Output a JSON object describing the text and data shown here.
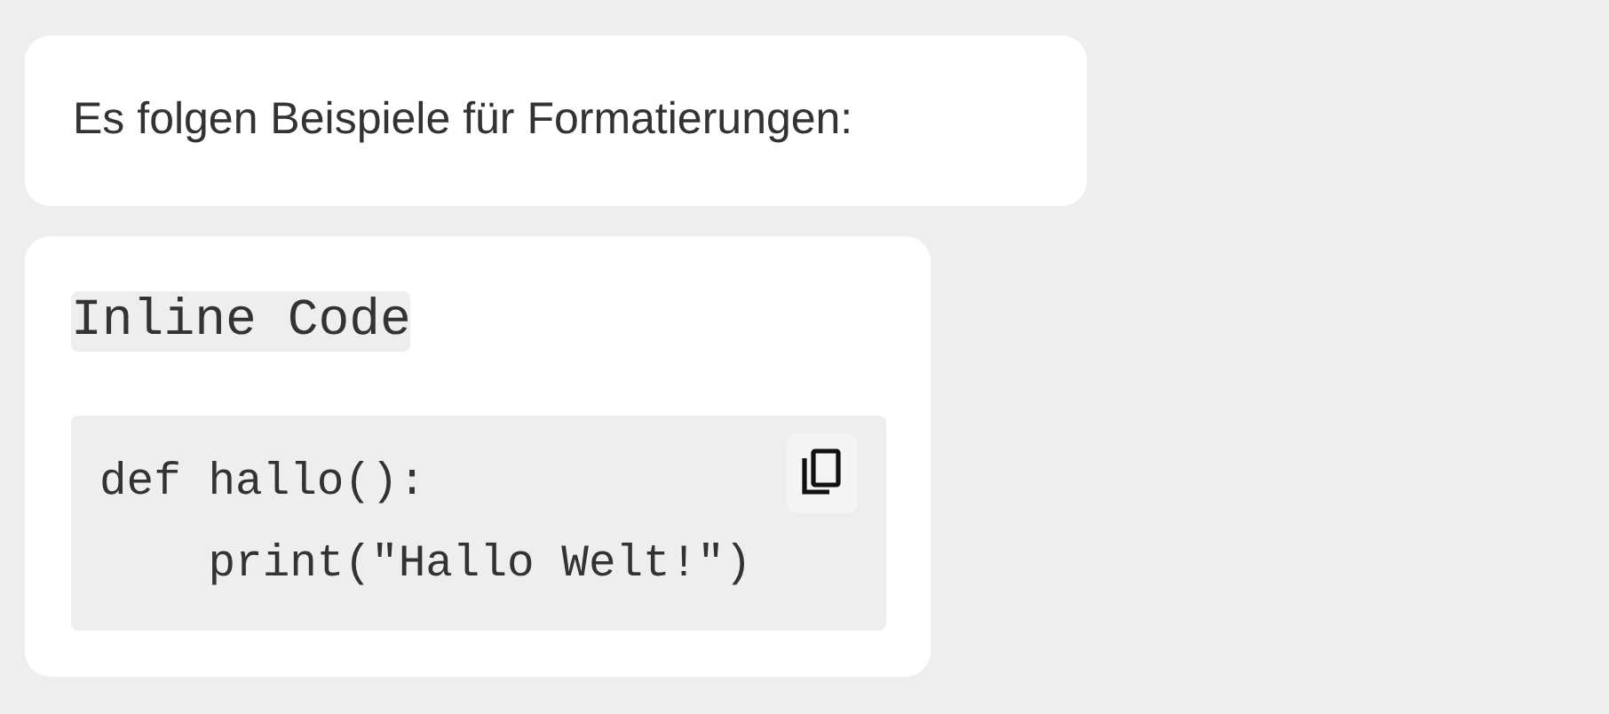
{
  "message": {
    "text": "Es folgen Beispiele für Formatierungen:"
  },
  "reply": {
    "inline_code": "Inline Code",
    "code_block": {
      "code": "def hallo():\n    print(\"Hallo Welt!\")"
    }
  }
}
